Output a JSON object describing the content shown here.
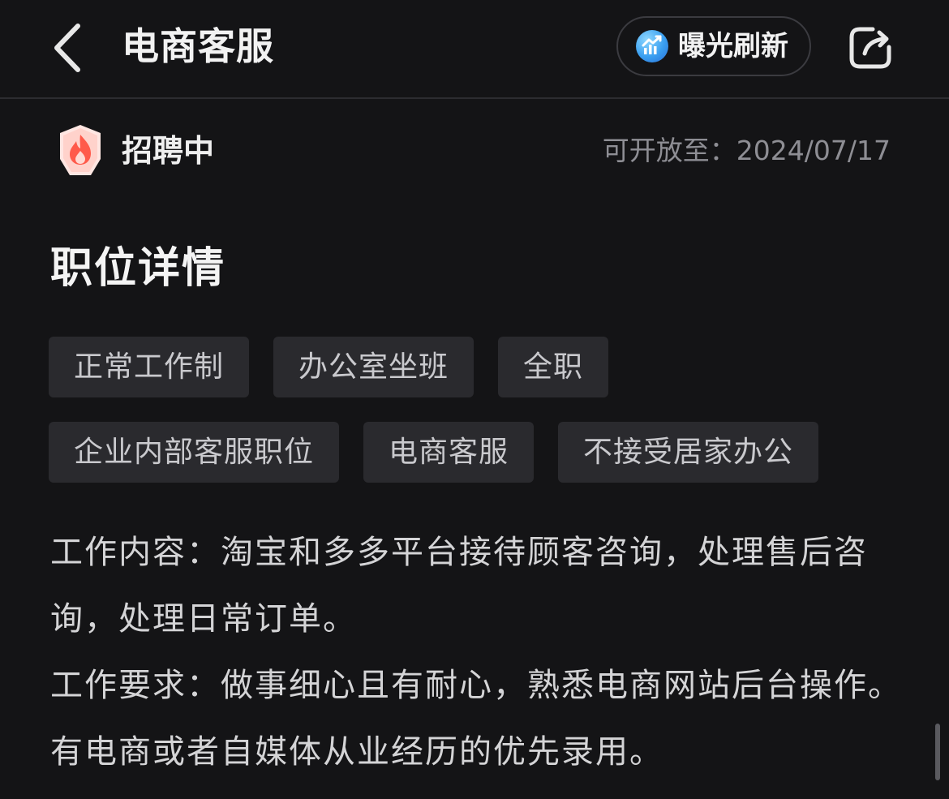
{
  "header": {
    "title": "电商客服",
    "refresh_label": "曝光刷新",
    "back_icon": "chevron-left-icon",
    "share_icon": "share-icon"
  },
  "status": {
    "label": "招聘中",
    "open_until": "可开放至：2024/07/17",
    "badge_color": "#ff6b5b"
  },
  "section": {
    "title": "职位详情"
  },
  "tags": {
    "row1": [
      "正常工作制",
      "办公室坐班",
      "全职"
    ],
    "row2": [
      "企业内部客服职位",
      "电商客服",
      "不接受居家办公"
    ]
  },
  "description": {
    "content": "工作内容：淘宝和多多平台接待顾客咨询，处理售后咨询，处理日常订单。",
    "requirements": "工作要求：做事细心且有耐心，熟悉电商网站后台操作。有电商或者自媒体从业经历的优先录用。"
  },
  "colors": {
    "background": "#141416",
    "tag_background": "#2a2a2e",
    "accent_blue": "#3a9ff0"
  }
}
